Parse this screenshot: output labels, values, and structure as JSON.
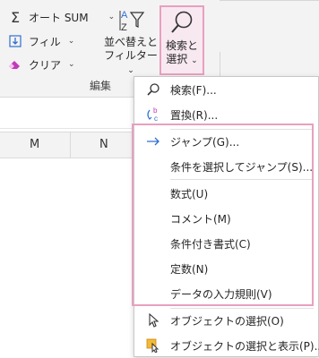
{
  "ribbon": {
    "autosum": "オート SUM",
    "fill": "フィル",
    "clear": "クリア",
    "sort_filter_line1": "並べ替えと",
    "sort_filter_line2": "フィルター",
    "find_select_line1": "検索と",
    "find_select_line2": "選択",
    "group_label": "編集"
  },
  "sheet": {
    "columns": [
      "M",
      "N"
    ]
  },
  "menu": {
    "items": [
      {
        "label": "検索(F)...",
        "icon": "search-icon"
      },
      {
        "label": "置換(R)...",
        "icon": "replace-icon"
      },
      {
        "label": "ジャンプ(G)...",
        "icon": "arrow-right-icon"
      },
      {
        "label": "条件を選択してジャンプ(S)...",
        "icon": ""
      },
      {
        "label": "数式(U)",
        "icon": ""
      },
      {
        "label": "コメント(M)",
        "icon": ""
      },
      {
        "label": "条件付き書式(C)",
        "icon": ""
      },
      {
        "label": "定数(N)",
        "icon": ""
      },
      {
        "label": "データの入力規則(V)",
        "icon": ""
      },
      {
        "label": "オブジェクトの選択(O)",
        "icon": "pointer-icon"
      },
      {
        "label": "オブジェクトの選択と表示(P)...",
        "icon": "selection-pane-icon"
      }
    ]
  },
  "colors": {
    "highlight_border": "#e8a0bf",
    "accent_blue": "#2f6fd0"
  }
}
